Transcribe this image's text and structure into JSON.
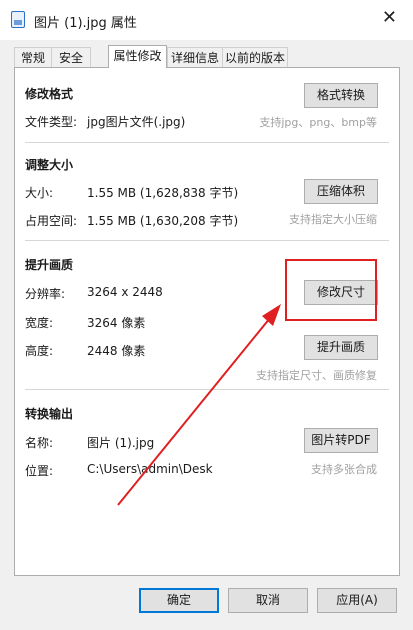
{
  "window": {
    "title": "图片 (1).jpg 属性",
    "close_glyph": "✕"
  },
  "tabs": [
    "常规",
    "安全",
    "属性修改",
    "详细信息",
    "以前的版本"
  ],
  "sections": {
    "format": {
      "title": "修改格式",
      "type_label": "文件类型:",
      "type_value": "jpg图片文件(.jpg)",
      "button": "格式转换",
      "hint": "支持jpg、png、bmp等"
    },
    "size": {
      "title": "调整大小",
      "size_label": "大小:",
      "size_value": "1.55 MB (1,628,838 字节)",
      "disk_label": "占用空间:",
      "disk_value": "1.55 MB (1,630,208 字节)",
      "button": "压缩体积",
      "hint": "支持指定大小压缩"
    },
    "quality": {
      "title": "提升画质",
      "resolution_label": "分辨率:",
      "resolution_value": "3264 x 2448",
      "width_label": "宽度:",
      "width_value": "3264 像素",
      "height_label": "高度:",
      "height_value": "2448 像素",
      "resize_button": "修改尺寸",
      "enhance_button": "提升画质",
      "hint": "支持指定尺寸、画质修复"
    },
    "convert": {
      "title": "转换输出",
      "name_label": "名称:",
      "name_value": "图片 (1).jpg",
      "location_label": "位置:",
      "location_value": "C:\\Users\\admin\\Desk",
      "button": "图片转PDF",
      "hint": "支持多张合成"
    }
  },
  "footer": {
    "ok": "确定",
    "cancel": "取消",
    "apply": "应用(A)"
  },
  "colors": {
    "highlight": "#e02020",
    "accent": "#0078d7"
  }
}
